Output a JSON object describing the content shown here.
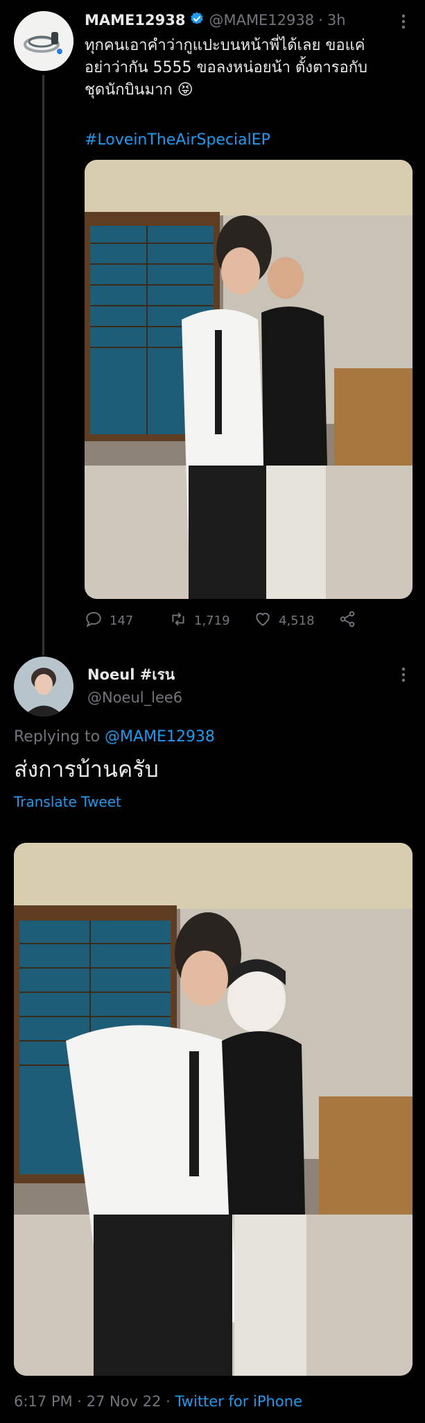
{
  "tweet1": {
    "display_name": "MAME12938",
    "handle": "@MAME12938",
    "time": "3h",
    "text_line1": "ทุกคนเอาคำว่ากูแปะบนหน้าพี่ได้เลย ขอแค่",
    "text_line2": "อย่าว่ากัน 5555 ขอลงหน่อยน้า ตั้งตารอกับ",
    "text_line3": "ชุดนักบินมาก 😝",
    "hashtag": "#LoveinTheAirSpecialEP",
    "replies": "147",
    "retweets": "1,719",
    "likes": "4,518"
  },
  "tweet2": {
    "display_name": "Noeul #เรน",
    "handle": "@Noeul_lee6",
    "replying_prefix": "Replying to",
    "replying_to": "@MAME12938",
    "text": "ส่งการบ้านครับ",
    "translate": "Translate Tweet",
    "timestamp": "6:17 PM · 27 Nov 22 · ",
    "source": "Twitter for iPhone"
  },
  "colors": {
    "background": "#000000",
    "text": "#e7e9ea",
    "muted": "#71767b",
    "link": "#1d9bf0",
    "verified": "#1d9bf0"
  },
  "icons": [
    "verified-badge-icon",
    "more-icon",
    "reply-icon",
    "retweet-icon",
    "like-icon",
    "share-icon"
  ]
}
